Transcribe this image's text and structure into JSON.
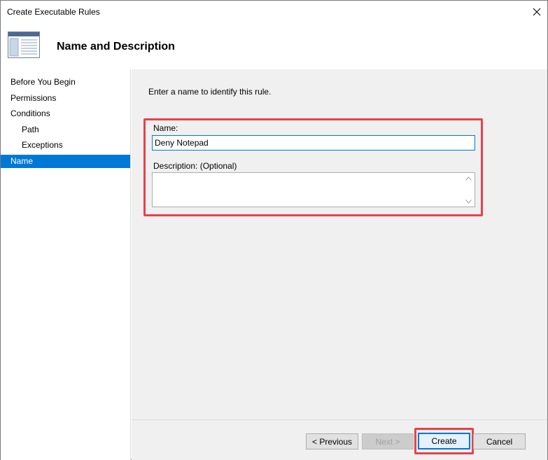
{
  "window": {
    "title": "Create Executable Rules",
    "close_icon": "close-icon"
  },
  "header": {
    "heading": "Name and Description",
    "icon": "wizard-page-icon"
  },
  "sidebar": {
    "items": [
      {
        "label": "Before You Begin",
        "active": false
      },
      {
        "label": "Permissions",
        "active": false
      },
      {
        "label": "Conditions",
        "active": false
      },
      {
        "label": "Path",
        "active": false
      },
      {
        "label": "Exceptions",
        "active": false
      },
      {
        "label": "Name",
        "active": true
      }
    ]
  },
  "main": {
    "intro": "Enter a name to identify this rule.",
    "name_label": "Name:",
    "name_value": "Deny Notepad",
    "description_label": "Description: (Optional)",
    "description_value": ""
  },
  "buttons": {
    "previous": "< Previous",
    "next": "Next >",
    "create": "Create",
    "cancel": "Cancel"
  },
  "colors": {
    "accent": "#0078d7",
    "highlight": "#e8414a",
    "panel_background": "#f0f0f0"
  }
}
